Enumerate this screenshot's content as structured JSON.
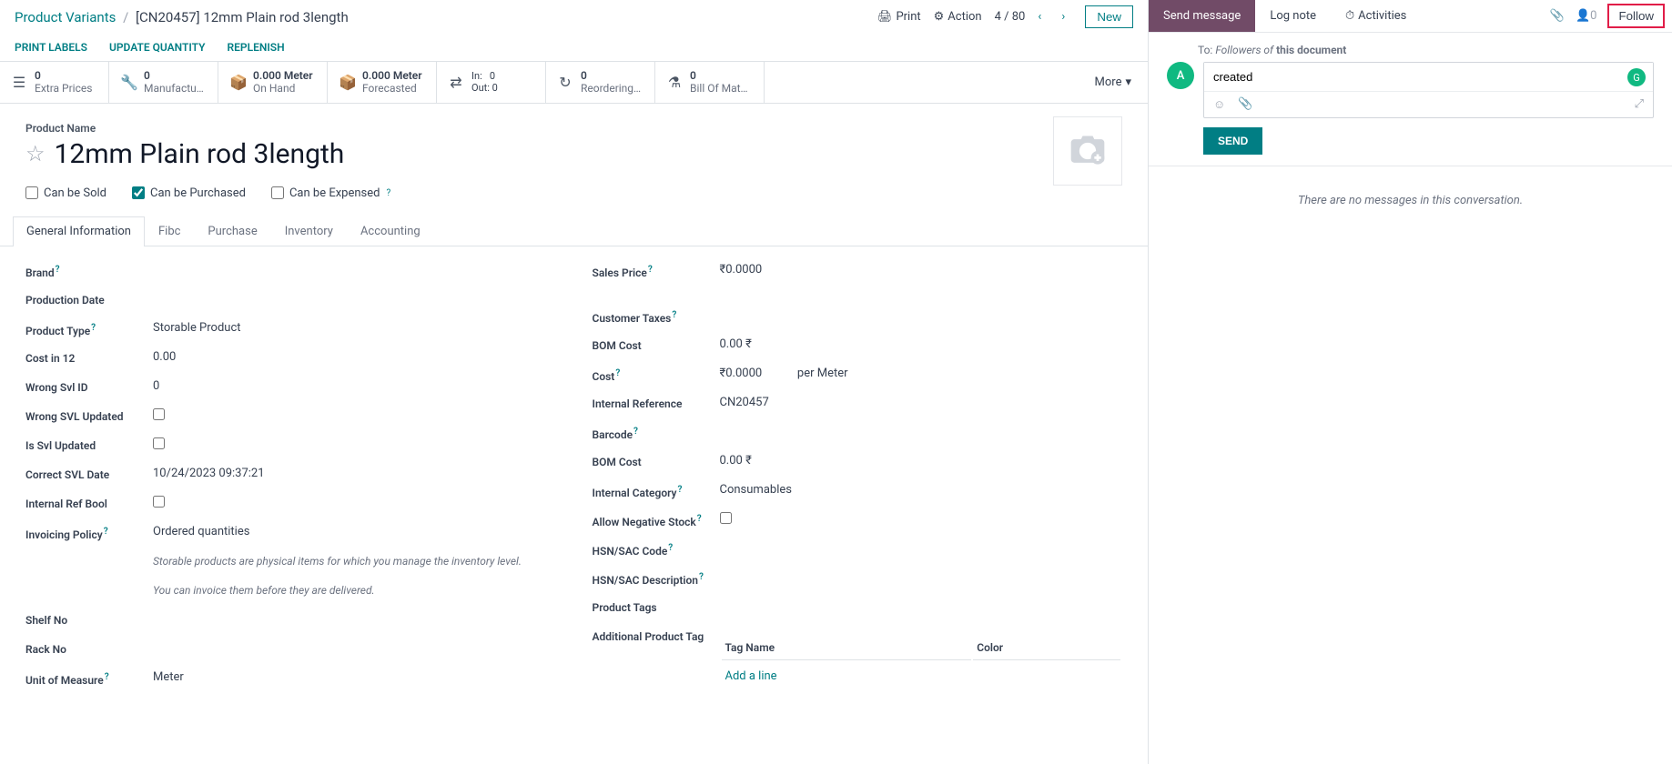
{
  "breadcrumb": {
    "root": "Product Variants",
    "current": "[CN20457] 12mm Plain rod 3length"
  },
  "header": {
    "print": "Print",
    "action": "Action",
    "pager": "4 / 80",
    "new": "New"
  },
  "sub_actions": {
    "print_labels": "PRINT LABELS",
    "update_qty": "UPDATE QUANTITY",
    "replenish": "REPLENISH"
  },
  "stats": {
    "extra_prices": {
      "value": "0",
      "label": "Extra Prices"
    },
    "manufacturing": {
      "value": "0",
      "label": "Manufactu…"
    },
    "on_hand": {
      "value": "0.000 Meter",
      "label": "On Hand"
    },
    "forecasted": {
      "value": "0.000 Meter",
      "label": "Forecasted"
    },
    "in": {
      "label": "In:",
      "value": "0"
    },
    "out": {
      "label": "Out:",
      "value": "0"
    },
    "reordering": {
      "value": "0",
      "label": "Reordering…"
    },
    "bom": {
      "value": "0",
      "label": "Bill Of Mat…"
    },
    "more": "More"
  },
  "product": {
    "label": "Product Name",
    "name": "12mm Plain rod 3length",
    "can_be_sold": "Can be Sold",
    "can_be_purchased": "Can be Purchased",
    "can_be_expensed": "Can be Expensed"
  },
  "tabs": {
    "general": "General Information",
    "fibc": "Fibc",
    "purchase": "Purchase",
    "inventory": "Inventory",
    "accounting": "Accounting"
  },
  "fields_left": {
    "brand": "Brand",
    "production_date": "Production Date",
    "product_type": "Product Type",
    "product_type_val": "Storable Product",
    "cost_in_12": "Cost in 12",
    "cost_in_12_val": "0.00",
    "wrong_svl_id": "Wrong Svl ID",
    "wrong_svl_id_val": "0",
    "wrong_svl_updated": "Wrong SVL Updated",
    "is_svl_updated": "Is Svl Updated",
    "correct_svl_date": "Correct SVL Date",
    "correct_svl_date_val": "10/24/2023 09:37:21",
    "internal_ref_bool": "Internal Ref Bool",
    "invoicing_policy": "Invoicing Policy",
    "invoicing_policy_val": "Ordered quantities",
    "help1": "Storable products are physical items for which you manage the inventory level.",
    "help2": "You can invoice them before they are delivered.",
    "shelf_no": "Shelf No",
    "rack_no": "Rack No",
    "uom": "Unit of Measure",
    "uom_val": "Meter"
  },
  "fields_right": {
    "sales_price": "Sales Price",
    "sales_price_val": "₹0.0000",
    "customer_taxes": "Customer Taxes",
    "bom_cost": "BOM Cost",
    "bom_cost_val": "0.00 ₹",
    "cost": "Cost",
    "cost_val": "₹0.0000",
    "cost_unit": "per Meter",
    "internal_ref": "Internal Reference",
    "internal_ref_val": "CN20457",
    "barcode": "Barcode",
    "bom_cost2": "BOM Cost",
    "bom_cost2_val": "0.00 ₹",
    "internal_category": "Internal Category",
    "internal_category_val": "Consumables",
    "allow_negative": "Allow Negative Stock",
    "hsn_code": "HSN/SAC Code",
    "hsn_desc": "HSN/SAC Description",
    "product_tags": "Product Tags",
    "additional_tag": "Additional Product Tag",
    "tag_col_name": "Tag Name",
    "tag_col_color": "Color",
    "add_line": "Add a line"
  },
  "chat": {
    "send_message": "Send message",
    "log_note": "Log note",
    "activities": "Activities",
    "follower_count": "0",
    "follow": "Follow",
    "to": "To:",
    "followers_of": "Followers of",
    "this_doc": "this document",
    "avatar_letter": "A",
    "input_value": "created",
    "send": "SEND",
    "empty": "There are no messages in this conversation."
  }
}
